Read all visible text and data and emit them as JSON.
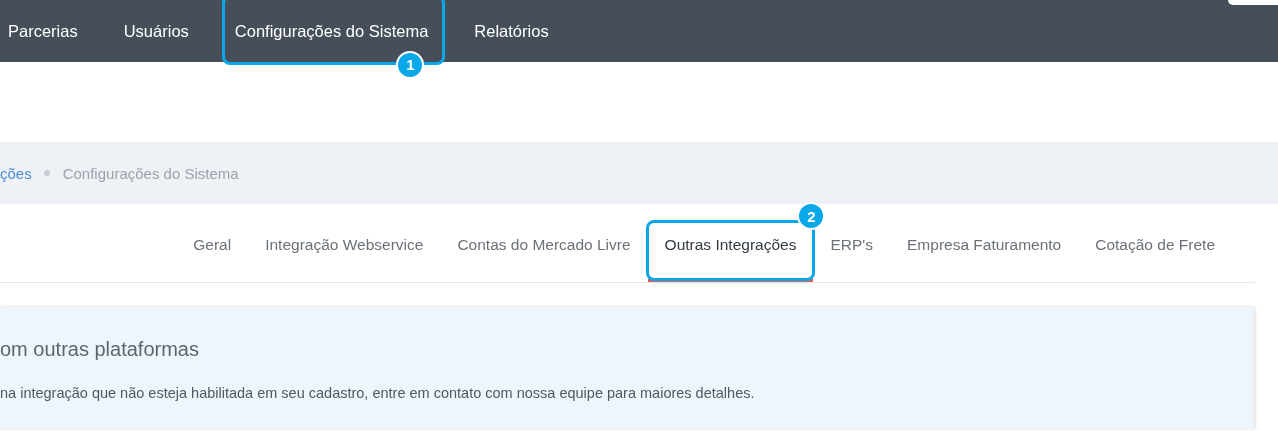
{
  "nav": {
    "items": [
      {
        "label": "Parcerias"
      },
      {
        "label": "Usuários"
      },
      {
        "label": "Configurações do Sistema",
        "callout": "1"
      },
      {
        "label": "Relatórios"
      }
    ]
  },
  "breadcrumb": [
    {
      "label": "ções",
      "kind": "link"
    },
    {
      "label": "Configurações do Sistema",
      "kind": "current"
    }
  ],
  "tabs": [
    {
      "label": "Geral",
      "selected": false
    },
    {
      "label": "Integração Webservice",
      "selected": false
    },
    {
      "label": "Contas do Mercado Livre",
      "selected": false
    },
    {
      "label": "Outras Integrações",
      "selected": true,
      "callout": "2"
    },
    {
      "label": "ERP's",
      "selected": false
    },
    {
      "label": "Empresa Faturamento",
      "selected": false
    },
    {
      "label": "Cotação de Frete",
      "selected": false
    }
  ],
  "panel": {
    "title": "om outras plataformas",
    "text": "na integração que não esteja habilitada em seu cadastro, entre em contato com nossa equipe para maiores detalhes."
  }
}
